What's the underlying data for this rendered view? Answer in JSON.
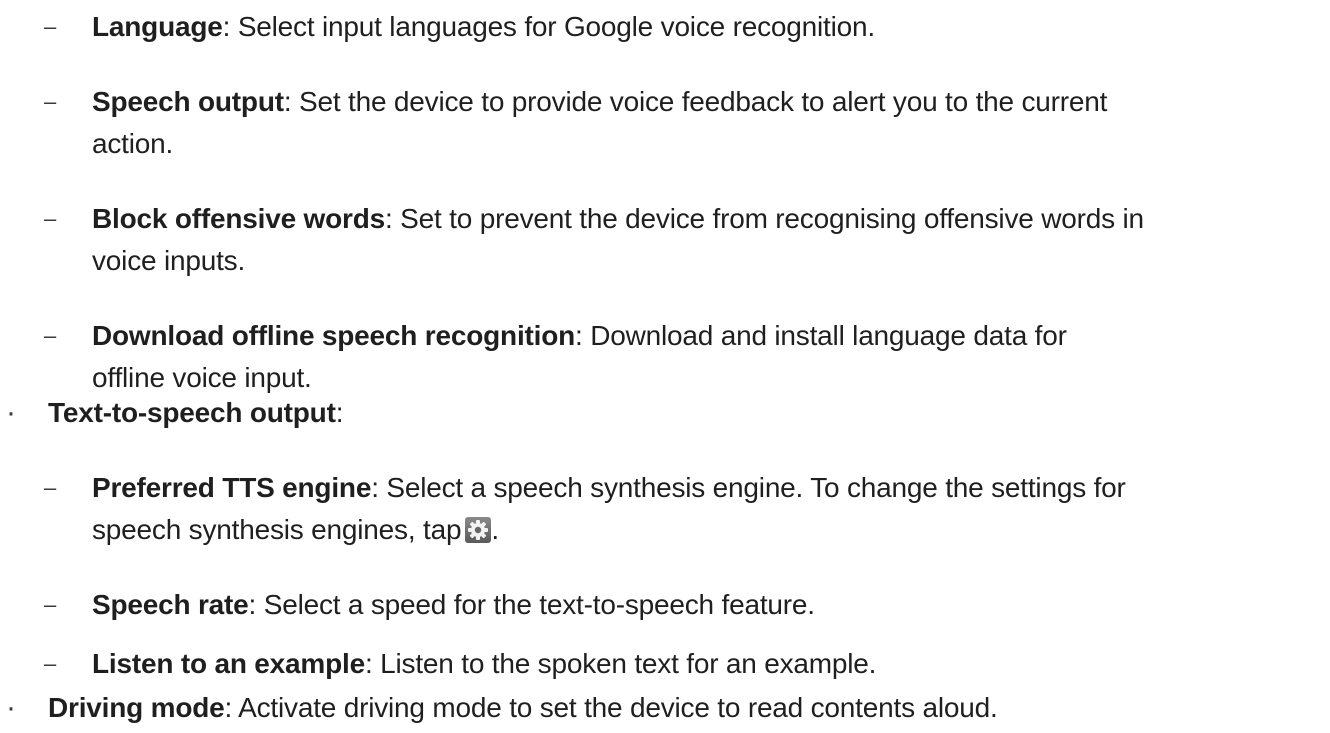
{
  "items": [
    {
      "marker": "–",
      "term": "Language",
      "sep": ": ",
      "desc": [
        "Select input languages for Google voice recognition."
      ]
    },
    {
      "marker": "–",
      "term": "Speech output",
      "sep": ": ",
      "desc": [
        "Set the device to provide voice feedback to alert you to the current",
        "action."
      ]
    },
    {
      "marker": "–",
      "term": "Block offensive words",
      "sep": ": ",
      "desc": [
        "Set to prevent the device from recognising offensive words in",
        "voice inputs."
      ]
    },
    {
      "marker": "–",
      "term": "Download offline speech recognition",
      "sep": ": ",
      "desc": [
        "Download and install language data for",
        "offline voice input."
      ]
    },
    {
      "marker": "·",
      "term": "Text-to-speech output",
      "sep": ":"
    },
    {
      "marker": "–",
      "term": "Preferred TTS engine",
      "sep": ": ",
      "desc": [
        "Select a speech synthesis engine. To change the settings for",
        "speech synthesis engines, tap"
      ],
      "trailing_icon": "settings-gear-icon",
      "after_icon": "."
    },
    {
      "marker": "–",
      "term": "Speech rate",
      "sep": ": ",
      "desc": [
        "Select a speed for the text-to-speech feature."
      ]
    },
    {
      "marker": "–",
      "term": "Listen to an example",
      "sep": ": ",
      "desc": [
        "Listen to the spoken text for an example."
      ]
    },
    {
      "marker": "·",
      "term": "Driving mode",
      "sep": ": ",
      "desc": [
        "Activate driving mode to set the device to read contents aloud."
      ]
    }
  ],
  "colors": {
    "text": "#1f1f1f",
    "gear_icon_bg": "#707070"
  }
}
